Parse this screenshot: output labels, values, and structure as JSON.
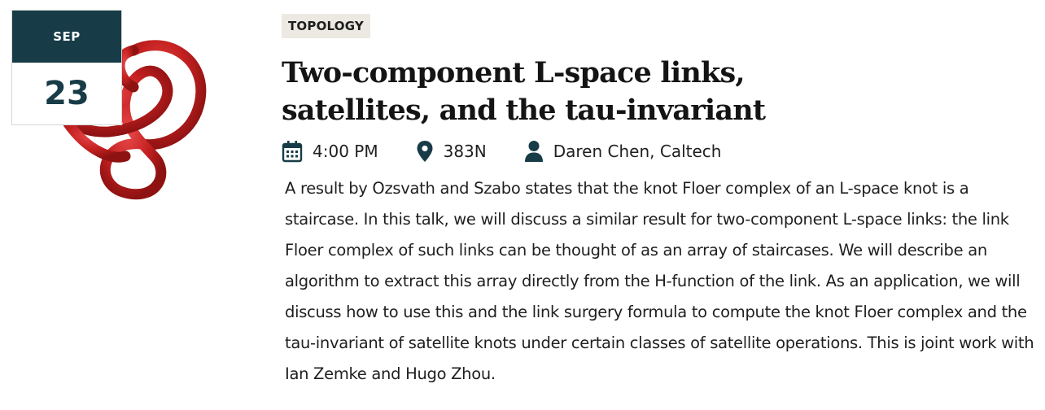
{
  "event": {
    "date": {
      "month": "SEP",
      "day": "23"
    },
    "category": "TOPOLOGY",
    "title_line1": "Two-component L-space links,",
    "title_line2": "satellites, and the tau-invariant",
    "time": "4:00 PM",
    "location": "383N",
    "speaker": "Daren Chen, Caltech",
    "description": "A result by Ozsvath and Szabo states that the knot Floer complex of an L-space knot is a staircase. In this talk, we will discuss a similar result for two-component L-space links: the link Floer complex of such links can be thought of as an array of staircases. We will describe an algorithm to extract this array directly from the H-function of the link. As an application, we will discuss how to use this and the link surgery formula to compute the knot Floer complex and the tau-invariant of satellite knots under certain classes of satellite operations. This is joint work with Ian Zemke and Hugo Zhou."
  },
  "icons": {
    "time": "calendar-icon",
    "location": "map-pin-icon",
    "speaker": "person-icon",
    "thumbnail": "knot-link-image"
  },
  "colors": {
    "accent": "#173c47",
    "knot": "#c42020",
    "category_bg": "#ece9e3"
  }
}
